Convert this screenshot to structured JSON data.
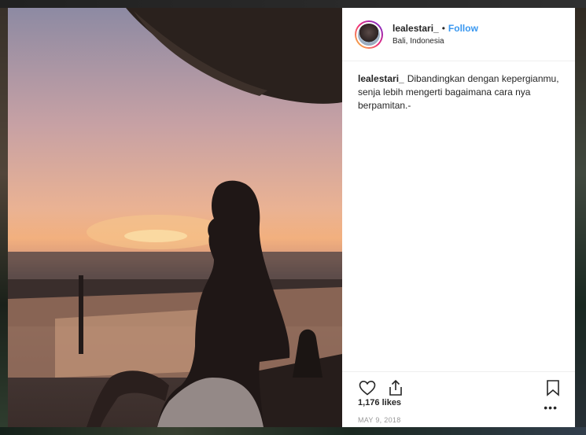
{
  "post": {
    "username": "lealestari_",
    "follow_label": "Follow",
    "separator": "•",
    "location": "Bali, Indonesia",
    "caption_user": "lealestari_",
    "caption_text": "Dibandingkan dengan kepergianmu, senja lebih mengerti bagaimana cara nya berpamitan.-",
    "likes": "1,176 likes",
    "date": "MAY 9, 2018",
    "more_label": "•••"
  },
  "icons": {
    "like": "heart-icon",
    "share": "share-icon",
    "save": "bookmark-icon",
    "more": "more-options-icon"
  },
  "colors": {
    "follow_blue": "#3897f0",
    "text": "#262626",
    "muted": "#999999"
  }
}
